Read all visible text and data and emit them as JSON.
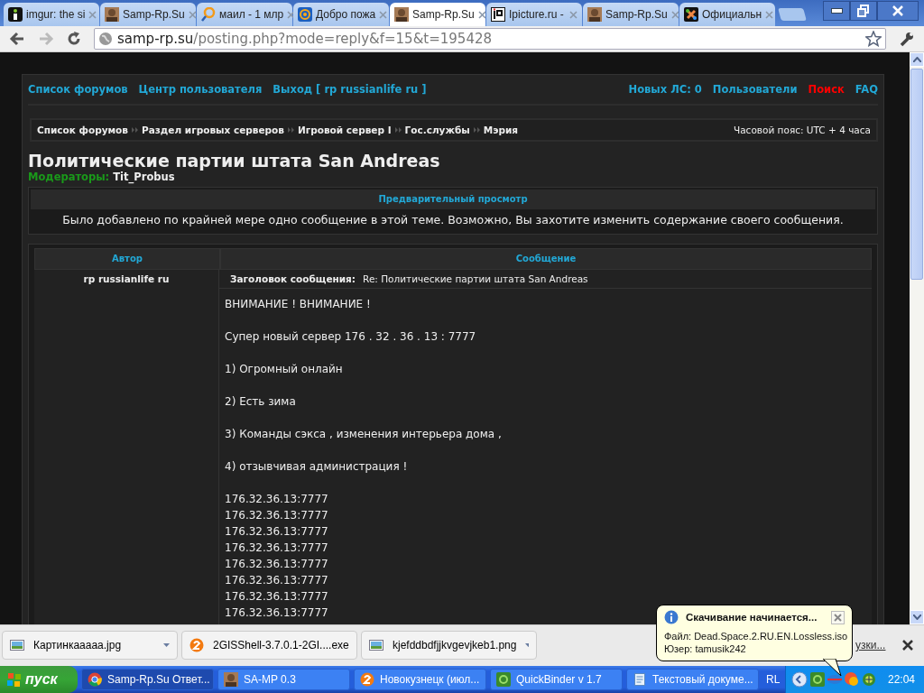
{
  "browser": {
    "tabs": [
      {
        "title": "imgur: the si",
        "kind": "info",
        "selected": false
      },
      {
        "title": "Samp-Rp.Su",
        "kind": "avatar",
        "selected": false
      },
      {
        "title": "маил - 1 млр",
        "kind": "magnifier",
        "selected": false
      },
      {
        "title": "Добро пожа",
        "kind": "at",
        "selected": false
      },
      {
        "title": "Samp-Rp.Su",
        "kind": "avatar",
        "selected": true
      },
      {
        "title": "Ipicture.ru -",
        "kind": "letters",
        "selected": false
      },
      {
        "title": "Samp-Rp.Su",
        "kind": "avatar",
        "selected": false
      },
      {
        "title": "Официальн",
        "kind": "puzzle",
        "selected": false
      }
    ],
    "address": {
      "host": "samp-rp.su",
      "path": "/posting.php?mode=reply&f=15&t=195428"
    }
  },
  "forum": {
    "nav_left": [
      "Список форумов",
      "Центр пользователя",
      "Выход [ rp russianlife ru ]"
    ],
    "nav_right": [
      {
        "label": "Новых ЛС: 0",
        "kind": "normal"
      },
      {
        "label": "Пользователи",
        "kind": "normal"
      },
      {
        "label": "Поиск",
        "kind": "alert"
      },
      {
        "label": "FAQ",
        "kind": "normal"
      }
    ],
    "breadcrumbs": [
      "Список форумов",
      "Раздел игровых серверов",
      "Игровой сервер I",
      "Гос.службы",
      "Мэрия"
    ],
    "timezone": "Часовой пояс: UTC + 4 часа",
    "title": "Политические партии штата San Andreas",
    "moderators_label": "Модераторы:",
    "moderators": "Tit_Probus",
    "preview": {
      "header": "Предварительный просмотр",
      "notice": "Было добавлено по крайней мере одно сообщение в этой теме. Возможно, Вы захотите изменить содержание своего сообщения."
    },
    "table": {
      "columns": [
        "Автор",
        "Сообщение"
      ],
      "author": "rp russianlife ru",
      "subject_label": "Заголовок сообщения:",
      "subject": "Re: Политические партии штата San Andreas",
      "paragraphs": [
        "ВНИМАНИЕ ! ВНИМАНИЕ !",
        "Супер новый сервер 176 . 32 . 36 . 13 : 7777",
        "1) Огромный онлайн",
        "2) Есть зима",
        "3) Команды сэкса , изменения интерьера дома ,",
        "4) отзывчивая администрация !"
      ],
      "lines": [
        "176.32.36.13:7777",
        "176.32.36.13:7777",
        "176.32.36.13:7777",
        "176.32.36.13:7777",
        "176.32.36.13:7777",
        "176.32.36.13:7777",
        "176.32.36.13:7777",
        "176.32.36.13:7777"
      ]
    }
  },
  "downloads": {
    "items": [
      {
        "name": "Картинкааааа.jpg",
        "kind": "image"
      },
      {
        "name": "2GISShell-3.7.0.1-2GI....exe",
        "kind": "circle"
      },
      {
        "name": "kjefddbdfjjkvgevjkeb1.png",
        "kind": "image"
      }
    ],
    "all_link": "узки..."
  },
  "notification": {
    "title": "Скачивание начинается...",
    "lines": [
      "Файл: Dead.Space.2.RU.EN.Lossless.iso",
      "Юзер: tamusik242"
    ]
  },
  "taskbar": {
    "start": "пуск",
    "items": [
      {
        "label": "Samp-Rp.Su Ответ...",
        "kind": "browser",
        "selected": true
      },
      {
        "label": "SA-MP 0.3",
        "kind": "avatar",
        "selected": false
      },
      {
        "label": "Новокузнецк (июл...",
        "kind": "circle",
        "selected": false
      },
      {
        "label": "QuickBinder v 1.7",
        "kind": "app",
        "selected": false
      },
      {
        "label": "Текстовый докуме...",
        "kind": "notepad",
        "selected": false
      }
    ],
    "language": "RL",
    "clock": "22:04"
  }
}
